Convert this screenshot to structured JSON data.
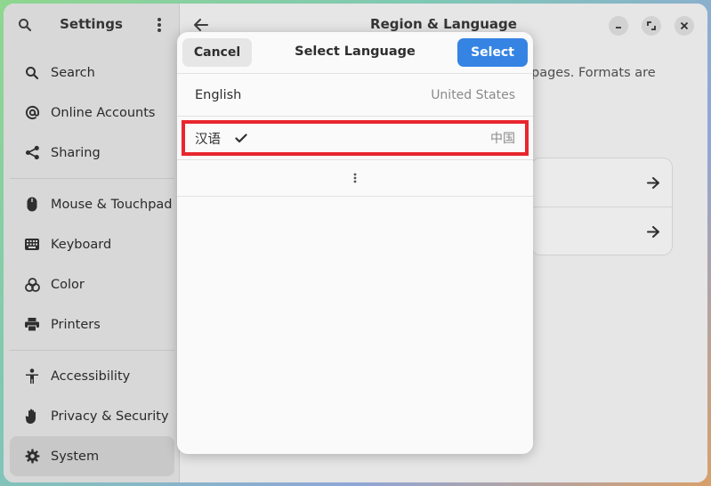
{
  "sidebar": {
    "title": "Settings",
    "items": [
      {
        "label": "Search",
        "icon": "search-icon"
      },
      {
        "label": "Online Accounts",
        "icon": "at-icon"
      },
      {
        "label": "Sharing",
        "icon": "share-icon"
      },
      {
        "label": "Mouse & Touchpad",
        "icon": "mouse-icon"
      },
      {
        "label": "Keyboard",
        "icon": "keyboard-icon"
      },
      {
        "label": "Color",
        "icon": "color-icon"
      },
      {
        "label": "Printers",
        "icon": "printer-icon"
      },
      {
        "label": "Accessibility",
        "icon": "accessibility-icon"
      },
      {
        "label": "Privacy & Security",
        "icon": "hand-icon"
      },
      {
        "label": "System",
        "icon": "gear-icon"
      }
    ],
    "active": "System"
  },
  "main": {
    "title": "Region & Language",
    "description": "pages. Formats are"
  },
  "dialog": {
    "title": "Select Language",
    "cancel_label": "Cancel",
    "select_label": "Select",
    "languages": [
      {
        "name": "English",
        "region": "United States"
      },
      {
        "name": "汉语",
        "region": "中国",
        "selected": true
      }
    ]
  },
  "colors": {
    "accent": "#3584e4",
    "highlight": "#e8262e"
  }
}
